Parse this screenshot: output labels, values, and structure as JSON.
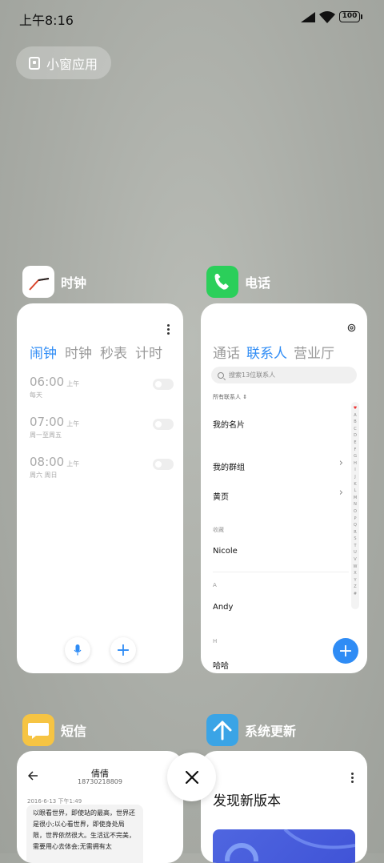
{
  "status_bar": {
    "time": "上午8:16",
    "battery": "100"
  },
  "mini_window": {
    "label": "小窗应用"
  },
  "apps": {
    "clock": {
      "name": "时钟",
      "tabs": [
        "闹钟",
        "时钟",
        "秒表",
        "计时"
      ],
      "alarms": [
        {
          "time": "06:00",
          "ampm": "上午",
          "repeat": "每天",
          "enabled": false
        },
        {
          "time": "07:00",
          "ampm": "上午",
          "repeat": "周一至周五",
          "enabled": false
        },
        {
          "time": "08:00",
          "ampm": "上午",
          "repeat": "周六 周日",
          "enabled": false
        }
      ]
    },
    "phone": {
      "name": "电话",
      "tabs": [
        "通话",
        "联系人",
        "营业厅"
      ],
      "search_placeholder": "搜索13位联系人",
      "all_contacts": "所有联系人",
      "my_card": "我的名片",
      "my_groups": "我的群组",
      "yellow_pages": "黄页",
      "favorites_header": "收藏",
      "contact_1": "Nicole",
      "section_a": "A",
      "contact_2": "Andy",
      "section_h": "H",
      "contact_3": "哈哈",
      "alphabet": "ABCDEFGHIJKLMNOPQRSTUVWXYZ#"
    },
    "sms": {
      "name": "短信",
      "contact_name": "倩倩",
      "contact_number": "18730218809",
      "timestamp": "2016-6-13 下午1:49",
      "message": "以眼看世界，即使站的最高，世界还是很小;以心看世界，即使身处局限，世界依然很大。生活远不完美，需要用心去体会;无需拥有太"
    },
    "update": {
      "name": "系统更新",
      "title": "发现新版本"
    }
  },
  "colors": {
    "accent": "#2f8cf5",
    "phone_green": "#2bcf5a",
    "sms_yellow": "#f6c443",
    "update_blue": "#3aa4e6"
  }
}
